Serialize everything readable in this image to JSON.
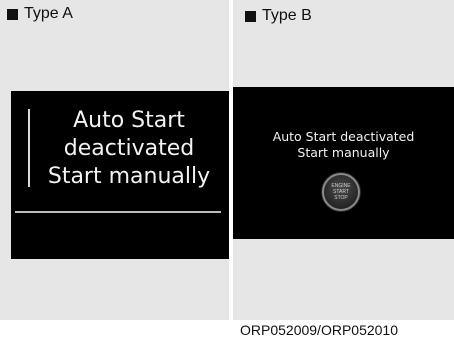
{
  "type_a": {
    "label": "Type A",
    "lines": [
      "Auto Start",
      "deactivated",
      "Start manually"
    ]
  },
  "type_b": {
    "label": "Type B",
    "lines": [
      "Auto Start deactivated",
      "Start manually"
    ],
    "engine_button": {
      "lines": [
        "ENGINE",
        "START",
        "STOP"
      ],
      "icon": "engine-start-stop-icon"
    }
  },
  "image_code": "ORP052009/ORP052010"
}
